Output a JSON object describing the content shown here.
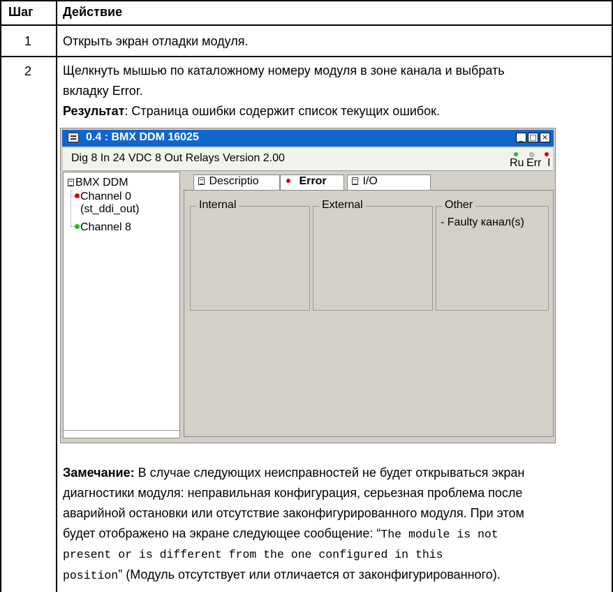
{
  "table": {
    "header_step": "Шаг",
    "header_action": "Действие",
    "row1_step": "1",
    "row1_action": "Открыть экран отладки модуля.",
    "row2_step": "2",
    "row2_line1": "Щелкнуть мышью по каталожному номеру модуля в зоне канала и выбрать",
    "row2_line2": "вкладку Error.",
    "result_label": "Результат",
    "result_text": ": Страница ошибки содержит список текущих ошибок.",
    "note_label": "Замечание:",
    "note_line1": " В случае следующих неисправностей не будет открываться экран",
    "note_line2": "диагностики модуля: неправильная конфигурация, серьезная проблема после",
    "note_line3": "аварийной остановки или отсутствие законфигурированного модуля. При этом",
    "note_line4_text": "будет отображено на экране следующее сообщение: “",
    "note_line4_mono": "The module is not",
    "note_line5_mono": "present or is different from the one configured in this",
    "note_line6_mono": "position",
    "note_line6_text": "” (Модуль отсутствует или отличается от законфигурированного)."
  },
  "window": {
    "title": "0.4 : BMX DDM 16025",
    "module_desc": "Dig 8 In 24 VDC 8 Out Relays Version 2.00",
    "leds": [
      {
        "label": "Ru",
        "color": "#22bb22"
      },
      {
        "label": "Err",
        "color": "#c8c8c8"
      },
      {
        "label": "I",
        "color": "#dd0000"
      }
    ],
    "tree": {
      "root": "BMX DDM",
      "channel0_line1": "Channel 0",
      "channel0_line2": "(st_ddi_out)",
      "channel8": "Channel 8"
    },
    "tabs": {
      "description": "Descriptio",
      "error": "Error",
      "io": "I/O"
    },
    "groups": {
      "internal": "Internal",
      "external": "External",
      "other": "Other",
      "other_item": "- Faulty канал(s)"
    }
  }
}
